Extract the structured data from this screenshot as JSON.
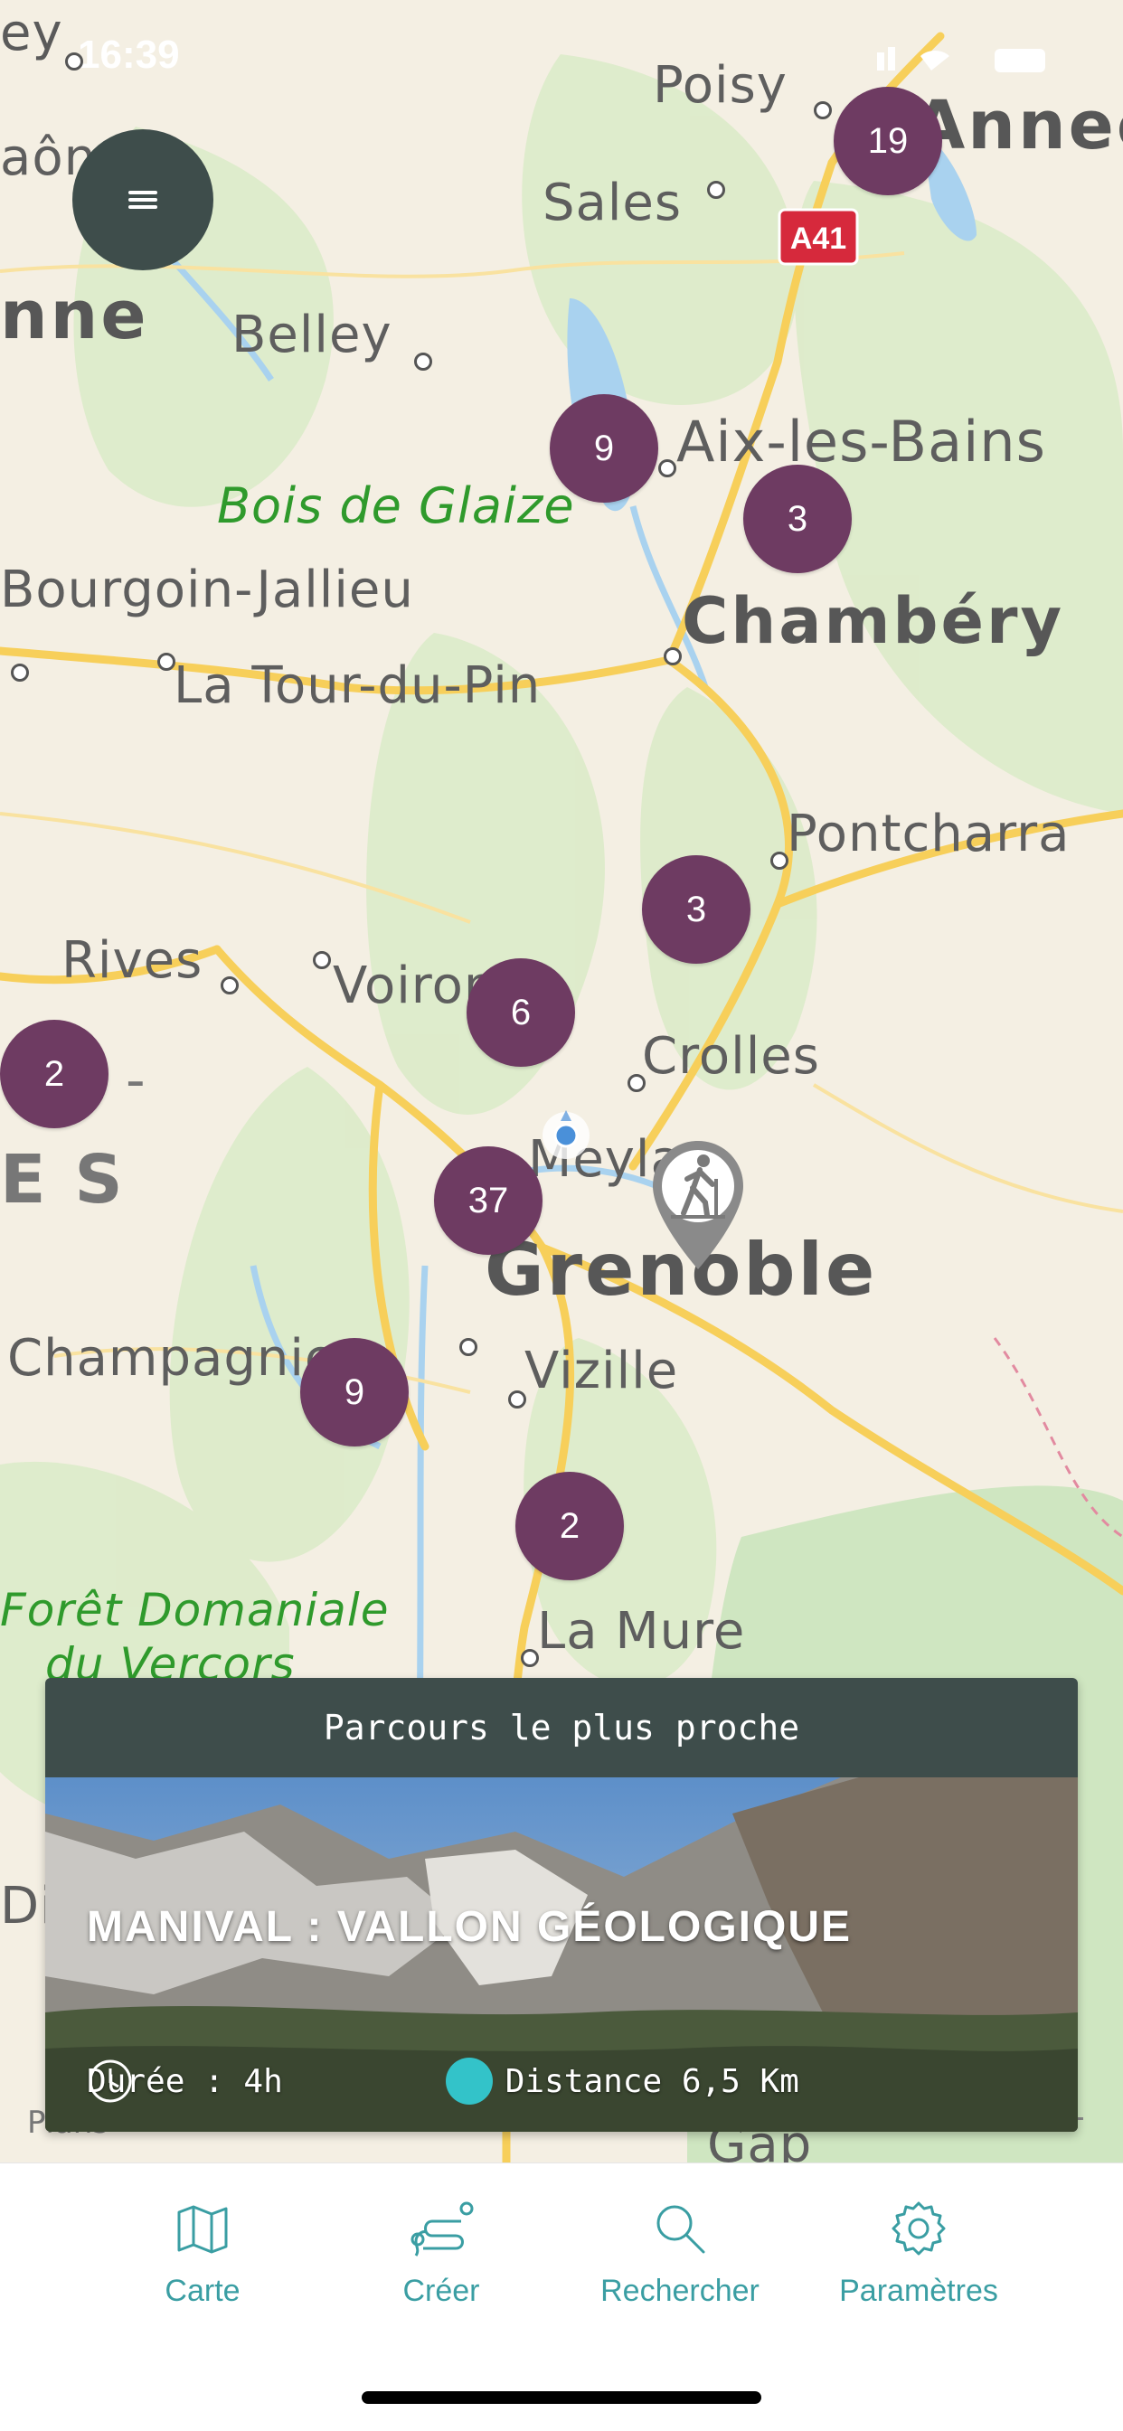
{
  "status_bar": {
    "time": "16:39"
  },
  "map": {
    "places": [
      {
        "name": "Poisy"
      },
      {
        "name": "Annecy"
      },
      {
        "name": "Sales"
      },
      {
        "name": "Belley"
      },
      {
        "name": "Aix-les-Bains"
      },
      {
        "name": "Chambéry"
      },
      {
        "name": "Bourgoin-Jallieu"
      },
      {
        "name": "La Tour-du-Pin"
      },
      {
        "name": "Pontcharra"
      },
      {
        "name": "Rives"
      },
      {
        "name": "Voiron"
      },
      {
        "name": "Crolles"
      },
      {
        "name": "Meylan"
      },
      {
        "name": "Grenoble"
      },
      {
        "name": "Champagnier"
      },
      {
        "name": "Vizille"
      },
      {
        "name": "La Mure"
      },
      {
        "name": "Gap"
      }
    ],
    "forests": [
      "Bois de Glaize",
      "Forêt Domaniale",
      "du Vercors"
    ],
    "road_shield": "A41",
    "partial_labels": {
      "left_top": "ey",
      "left_mid": "aôn",
      "left_big": "nne",
      "left_es": "E S",
      "left_dash": "E -",
      "left_di": "Di"
    },
    "clusters": [
      "19",
      "9",
      "3",
      "3",
      "6",
      "2",
      "37",
      "9",
      "2"
    ],
    "attribution": "Plans"
  },
  "menu": {
    "icon": "hamburger-icon"
  },
  "nearest_card": {
    "header": "Parcours le plus proche",
    "title": "MANIVAL : VALLON GÉOLOGIQUE",
    "duration": "Durée : 4h",
    "distance": "Distance 6,5 Km"
  },
  "tabs": [
    {
      "label": "Carte",
      "icon": "map-icon"
    },
    {
      "label": "Créer",
      "icon": "route-create-icon"
    },
    {
      "label": "Rechercher",
      "icon": "search-icon"
    },
    {
      "label": "Paramètres",
      "icon": "gear-icon"
    }
  ],
  "colors": {
    "cluster": "#6e3b62",
    "header": "#3e4d4b",
    "accent": "#3a9ea3",
    "teal_dot": "#33c3c9"
  }
}
